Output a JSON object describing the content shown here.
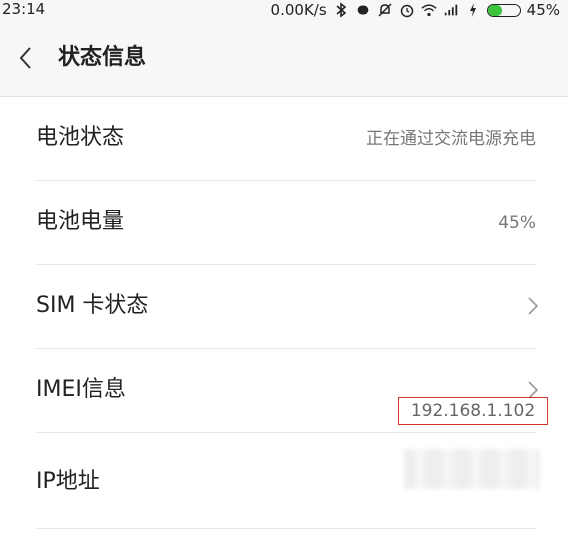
{
  "status_bar": {
    "time": "23:14",
    "network_speed": "0.00K/s",
    "battery_percent": "45%",
    "battery_level": 0.45,
    "icons": [
      "bluetooth-icon",
      "vibrate-icon",
      "mute-icon",
      "alarm-icon",
      "wifi-icon",
      "signal-icon",
      "charging-icon",
      "battery-icon"
    ],
    "accent_color": "#3cc43c"
  },
  "header": {
    "back_icon": "chevron-left-icon",
    "title": "状态信息"
  },
  "rows": [
    {
      "label": "电池状态",
      "value": "正在通过交流电源充电"
    },
    {
      "label": "电池电量",
      "value": "45%"
    },
    {
      "label": "SIM 卡状态",
      "icon": "chevron-right-icon"
    },
    {
      "label": "IMEI信息",
      "icon": "chevron-right-icon"
    },
    {
      "label": "IP地址",
      "value": "192.168.1.102",
      "highlight_color": "#d9322c"
    }
  ]
}
